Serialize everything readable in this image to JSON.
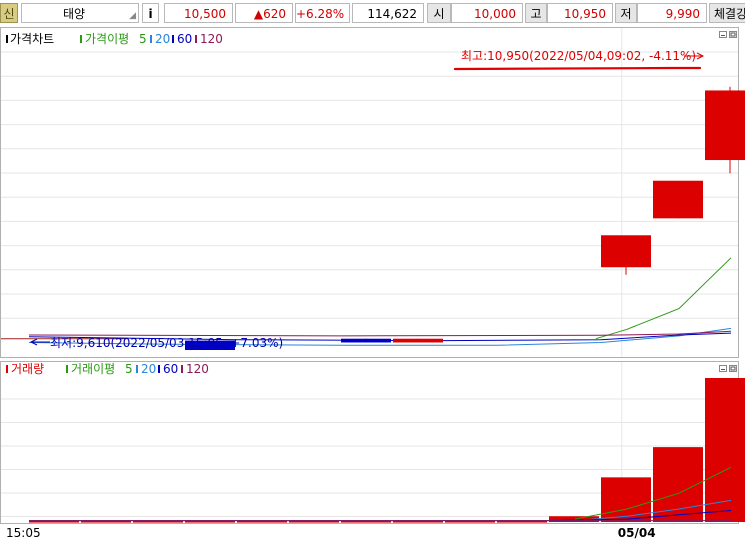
{
  "header": {
    "badge": "신",
    "stock_name": "태양",
    "info_icon": "i",
    "price": "10,500",
    "change": "▲620",
    "change_pct": "+6.28%",
    "volume": "114,622",
    "open_label": "시",
    "open": "10,000",
    "high_label": "고",
    "high": "10,950",
    "low_label": "저",
    "low": "9,990",
    "fill_label": "체결강"
  },
  "price_panel": {
    "legend_main": "가격차트",
    "legend_ma": "가격이평",
    "ma": [
      "5",
      "20",
      "60",
      "120"
    ]
  },
  "volume_panel": {
    "legend_main": "거래량",
    "legend_ma": "거래이평",
    "ma": [
      "5",
      "20",
      "60",
      "120"
    ]
  },
  "colors": {
    "up": "#dd0000",
    "down": "#0000c8",
    "ma5": "#2a9a12",
    "ma20": "#2a86d8",
    "ma60": "#0000c0",
    "ma120": "#8c1a5a",
    "highlight": "#e00000"
  },
  "chart_data": [
    {
      "type": "candlestick",
      "scale": "data units (KRW price); only visible candles recorded",
      "ylim": [
        9550,
        11060
      ],
      "annotations": {
        "high_label": "최고:10,950(2022/05/04,09:02, -4.11%)",
        "low_label": "최저:9,610(2022/05/03,15:05, +7.03%)"
      },
      "candles": [
        {
          "slot": 3,
          "open": 9600,
          "high": 9600,
          "low": 9550,
          "close": 9550
        },
        {
          "slot": 6,
          "open": 9610,
          "high": 9610,
          "low": 9590,
          "close": 9590
        },
        {
          "slot": 7,
          "open": 9590,
          "high": 9610,
          "low": 9590,
          "close": 9610
        },
        {
          "slot": 11,
          "open": 9990,
          "high": 10120,
          "low": 9950,
          "close": 10160
        },
        {
          "slot": 12,
          "open": 10250,
          "high": 10380,
          "low": 10250,
          "close": 10450
        },
        {
          "slot": 13,
          "open": 10560,
          "high": 10950,
          "low": 10490,
          "close": 10930
        }
      ],
      "ma_series": [
        {
          "key": "ma5",
          "name": "5",
          "points": [
            [
              10.9,
              9610
            ],
            [
              11.5,
              9660
            ],
            [
              12.5,
              9770
            ],
            [
              13.5,
              10040
            ]
          ]
        },
        {
          "key": "ma20",
          "name": "20",
          "points": [
            [
              0,
              9590
            ],
            [
              3,
              9580
            ],
            [
              6,
              9575
            ],
            [
              9,
              9575
            ],
            [
              11,
              9590
            ],
            [
              12.5,
              9625
            ],
            [
              13.5,
              9665
            ]
          ]
        },
        {
          "key": "ma60",
          "name": "60",
          "points": [
            [
              0,
              9620
            ],
            [
              4,
              9605
            ],
            [
              8,
              9600
            ],
            [
              11,
              9605
            ],
            [
              12.5,
              9630
            ],
            [
              13.5,
              9640
            ]
          ]
        },
        {
          "key": "ma120",
          "name": "120",
          "points": [
            [
              0,
              9630
            ],
            [
              6,
              9625
            ],
            [
              11,
              9628
            ],
            [
              12.5,
              9635
            ],
            [
              13.5,
              9650
            ]
          ]
        }
      ],
      "baseline_price": 9610
    },
    {
      "type": "bar",
      "scale": "relative volume, 0-100 (no axis values printed)",
      "ylim": [
        0,
        100
      ],
      "values": [
        {
          "slot": 0,
          "value": 1
        },
        {
          "slot": 1,
          "value": 1
        },
        {
          "slot": 2,
          "value": 1
        },
        {
          "slot": 3,
          "value": 1
        },
        {
          "slot": 4,
          "value": 1
        },
        {
          "slot": 5,
          "value": 1
        },
        {
          "slot": 6,
          "value": 1
        },
        {
          "slot": 7,
          "value": 1
        },
        {
          "slot": 8,
          "value": 1
        },
        {
          "slot": 9,
          "value": 1
        },
        {
          "slot": 10,
          "value": 4
        },
        {
          "slot": 11,
          "value": 31
        },
        {
          "slot": 12,
          "value": 52
        },
        {
          "slot": 13,
          "value": 100
        }
      ],
      "ma_series": [
        {
          "key": "ma5",
          "name": "5",
          "points": [
            [
              10.5,
              2
            ],
            [
              11.5,
              9
            ],
            [
              12.5,
              20
            ],
            [
              13.5,
              38
            ]
          ]
        },
        {
          "key": "ma20",
          "name": "20",
          "points": [
            [
              10.5,
              1
            ],
            [
              11.5,
              4
            ],
            [
              12.5,
              9
            ],
            [
              13.5,
              15
            ]
          ]
        },
        {
          "key": "ma60",
          "name": "60",
          "points": [
            [
              0,
              1
            ],
            [
              10,
              1
            ],
            [
              11.5,
              2
            ],
            [
              12.5,
              5
            ],
            [
              13.5,
              8
            ]
          ]
        },
        {
          "key": "ma120",
          "name": "120",
          "points": [
            [
              0,
              1
            ],
            [
              13.5,
              1
            ]
          ]
        }
      ]
    }
  ],
  "x_axis": {
    "ticks": [
      {
        "label": "15:05",
        "pos": 0
      },
      {
        "label": "05/04",
        "pos": 11.4,
        "bold": true
      }
    ]
  }
}
